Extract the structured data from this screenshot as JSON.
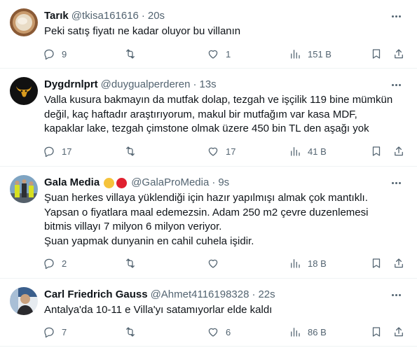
{
  "tweets": [
    {
      "name": "Tarık",
      "handle": "@tkisa161616",
      "sep": "·",
      "time": "20s",
      "lines": [
        "Peki satış fiyatı ne kadar oluyor bu villanın"
      ],
      "replies": "9",
      "retweets": "",
      "likes": "1",
      "views": "151 B"
    },
    {
      "name": "Dygdrnlprt",
      "handle": "@duygualperderen",
      "sep": "·",
      "time": "13s",
      "lines": [
        "Valla kusura bakmayın da mutfak dolap, tezgah ve işçilik 119 bine mümkün",
        "değil, kaç haftadır araştırıyorum, makul bir mutfağım var kasa MDF,",
        "kapaklar lake, tezgah çimstone olmak üzere 450 bin TL den aşağı yok"
      ],
      "replies": "17",
      "retweets": "",
      "likes": "17",
      "views": "41 B"
    },
    {
      "name": "Gala Media",
      "handle": "@GalaProMedia",
      "sep": "·",
      "time": "9s",
      "badge_colors": [
        "#f5c33b",
        "#e0202f"
      ],
      "lines": [
        "Şuan herkes villaya yüklendiği için hazır yapılmışı almak çok mantıklı.",
        "Yapsan o fiyatlara maal edemezsin. Adam 250 m2 çevre duzenlemesi",
        "bitmis villayı 7 milyon 6 milyon veriyor.",
        "Şuan yapmak dunyanin en cahil cuhela işidir."
      ],
      "replies": "2",
      "retweets": "",
      "likes": "",
      "views": "18 B"
    },
    {
      "name": "Carl Friedrich Gauss",
      "handle": "@Ahmet4116198328",
      "sep": "·",
      "time": "22s",
      "lines": [
        "Antalya'da 10-11 e Villa'yı satamıyorlar elde kaldı"
      ],
      "replies": "7",
      "retweets": "",
      "likes": "6",
      "views": "86 B"
    }
  ],
  "icons": {
    "reply": "reply-icon",
    "retweet": "retweet-icon",
    "like": "heart-icon",
    "views": "views-chart-icon",
    "bookmark": "bookmark-icon",
    "share": "share-icon",
    "more": "more-icon"
  }
}
